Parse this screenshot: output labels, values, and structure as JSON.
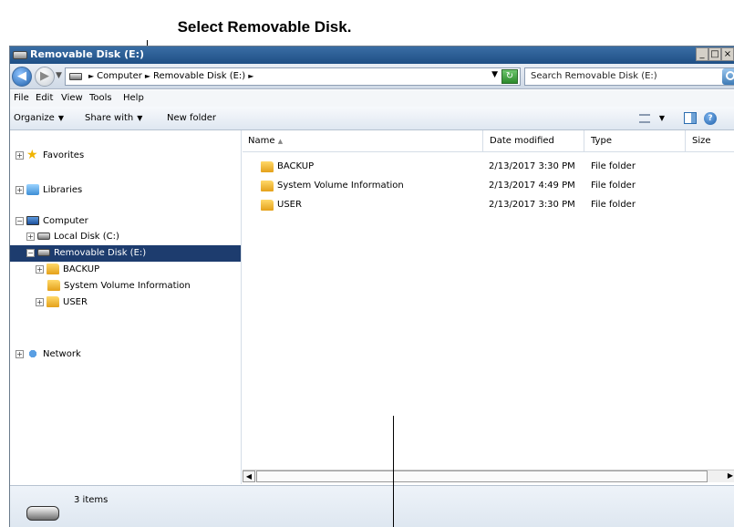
{
  "annotation": {
    "top_text": "Select Removable Disk."
  },
  "window": {
    "title": "Removable Disk (E:)",
    "caption_buttons": [
      "_",
      "□",
      "×"
    ]
  },
  "address_bar": {
    "crumbs": [
      "Computer",
      "Removable Disk (E:)"
    ],
    "search_placeholder": "Search Removable Disk (E:)"
  },
  "menu": {
    "items": [
      "File",
      "Edit",
      "View",
      "Tools",
      "Help"
    ]
  },
  "toolbar": {
    "organize": "Organize",
    "share_with": "Share with",
    "new_folder": "New folder",
    "help_glyph": "?"
  },
  "nav_tree": {
    "favorites": "Favorites",
    "libraries": "Libraries",
    "computer": "Computer",
    "local_disk": "Local Disk (C:)",
    "removable_disk": "Removable Disk (E:)",
    "children": [
      "BACKUP",
      "System Volume Information",
      "USER"
    ],
    "network": "Network"
  },
  "columns": {
    "name": "Name",
    "date": "Date modified",
    "type": "Type",
    "size": "Size"
  },
  "files": [
    {
      "name": "BACKUP",
      "date": "2/13/2017 3:30 PM",
      "type": "File folder"
    },
    {
      "name": "System Volume Information",
      "date": "2/13/2017 4:49 PM",
      "type": "File folder"
    },
    {
      "name": "USER",
      "date": "2/13/2017 3:30 PM",
      "type": "File folder"
    }
  ],
  "status": {
    "count_text": "3 items"
  },
  "colors": {
    "title_bar": "#2b5a92",
    "selection": "#1d3c6e",
    "folder": "#f2c14e"
  }
}
